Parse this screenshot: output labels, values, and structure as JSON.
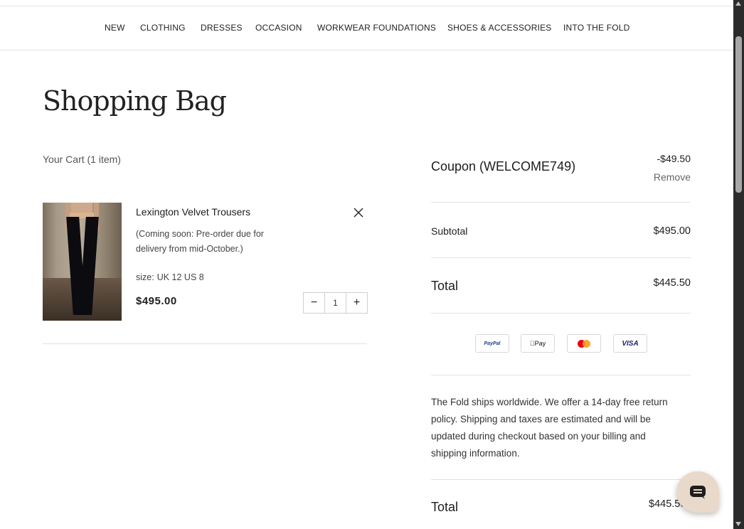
{
  "nav": {
    "items": [
      "NEW",
      "CLOTHING",
      "DRESSES",
      "OCCASION",
      "WORKWEAR FOUNDATIONS",
      "SHOES & ACCESSORIES",
      "INTO THE FOLD"
    ]
  },
  "page": {
    "title": "Shopping Bag"
  },
  "cart": {
    "count_label": "Your Cart (1 item)",
    "item": {
      "name": "Lexington Velvet Trousers",
      "note": "(Coming soon: Pre-order due for delivery from mid-October.)",
      "size_label": "size:",
      "size_value": "UK 12 US 8",
      "price": "$495.00",
      "quantity": "1",
      "decrement": "−",
      "increment": "+"
    }
  },
  "summary": {
    "coupon_label": "Coupon (WELCOME749)",
    "coupon_amount": "-$49.50",
    "remove_label": "Remove",
    "subtotal_label": "Subtotal",
    "subtotal_amount": "$495.00",
    "total_label": "Total",
    "total_amount": "$445.50",
    "payments": [
      "PayPal",
      "Pay",
      "mastercard",
      "VISA"
    ],
    "shipping_text": "The Fold ships worldwide. We offer a 14-day free return policy. Shipping and taxes are estimated and will be updated during checkout based on your billing and shipping information.",
    "total2_label": "Total",
    "total2_amount": "$445.50"
  }
}
